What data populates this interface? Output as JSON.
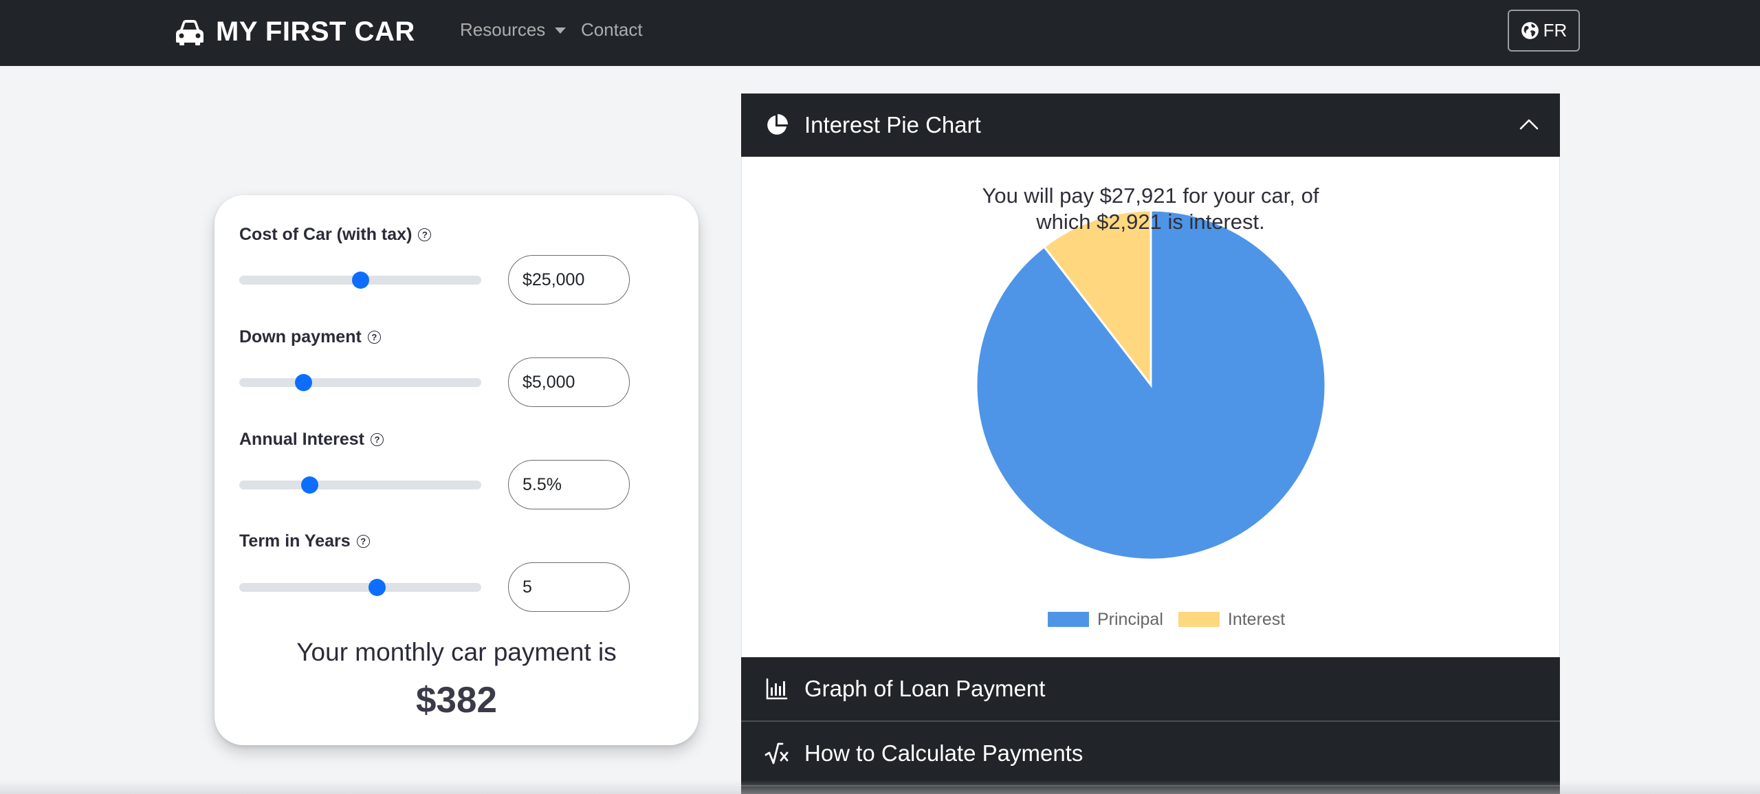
{
  "nav": {
    "brand": "MY FIRST CAR",
    "resources": "Resources",
    "contact": "Contact",
    "language": "FR"
  },
  "calculator": {
    "fields": [
      {
        "label": "Cost of Car (with tax)",
        "value": "$25,000",
        "slider_fraction": 0.5
      },
      {
        "label": "Down payment",
        "value": "$5,000",
        "slider_fraction": 0.265
      },
      {
        "label": "Annual Interest",
        "value": "5.5%",
        "slider_fraction": 0.29
      },
      {
        "label": "Term in Years",
        "value": "5",
        "slider_fraction": 0.57
      }
    ],
    "result_label": "Your monthly car payment is",
    "result_value": "$382"
  },
  "accordion": {
    "pie_header": "Interest Pie Chart",
    "graph_header": "Graph of Loan Payment",
    "calc_header": "How to Calculate Payments"
  },
  "chart_data": {
    "type": "pie",
    "title_line1": "You will pay $27,921 for your car, of",
    "title_line2": "which $2,921 is interest.",
    "categories": [
      "Principal",
      "Interest"
    ],
    "values": [
      25000,
      2921
    ],
    "colors": [
      "#4e95e8",
      "#ffd77f"
    ],
    "legend": "bottom"
  },
  "colors": {
    "navbar": "#212529",
    "accent": "#0d6efd"
  }
}
